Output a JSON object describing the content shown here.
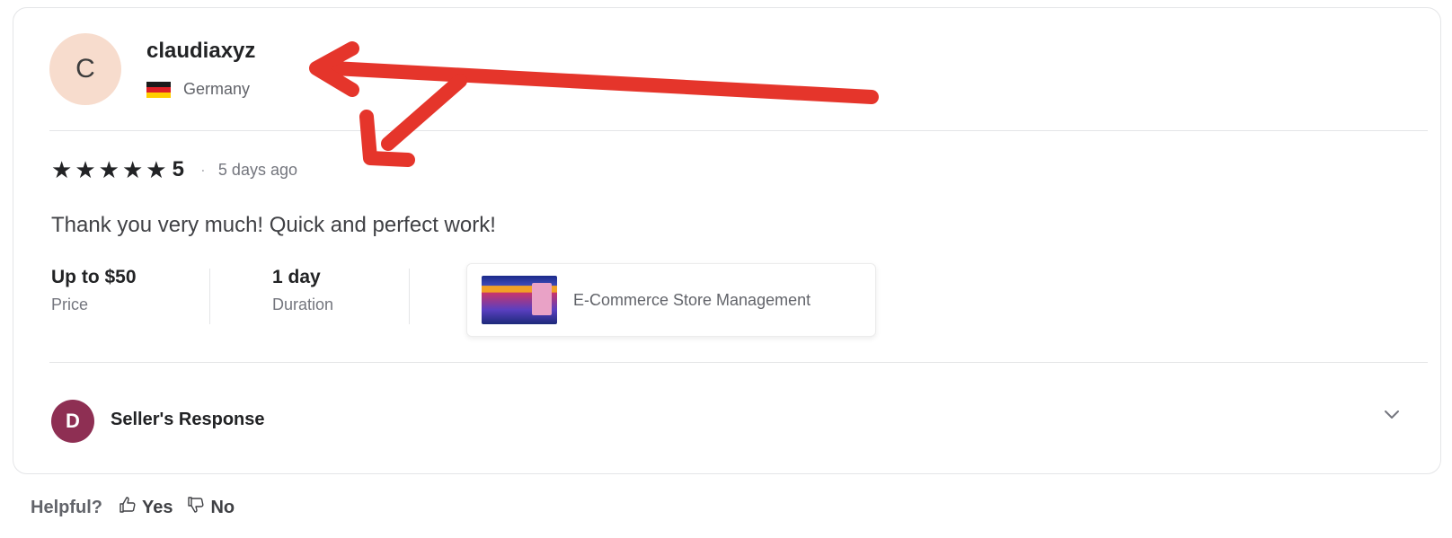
{
  "review": {
    "avatar_letter": "C",
    "username": "claudiaxyz",
    "country": "Germany",
    "rating": 5,
    "rating_display": "5",
    "separator": "·",
    "time_ago": "5 days ago",
    "text": "Thank you very much! Quick and perfect work!",
    "price": {
      "value": "Up to $50",
      "label": "Price"
    },
    "duration": {
      "value": "1 day",
      "label": "Duration"
    },
    "gig": {
      "title": "E-Commerce Store Management"
    }
  },
  "seller_response": {
    "avatar_letter": "D",
    "label": "Seller's Response"
  },
  "helpful": {
    "question": "Helpful?",
    "yes_label": "Yes",
    "no_label": "No"
  },
  "colors": {
    "annotation_arrow": "#e5352b",
    "avatar_bg": "#f7dccd",
    "seller_avatar_bg": "#8e2f53"
  },
  "icons": [
    "star-icon",
    "flag-germany-icon",
    "chevron-down-icon",
    "thumbs-up-icon",
    "thumbs-down-icon"
  ]
}
